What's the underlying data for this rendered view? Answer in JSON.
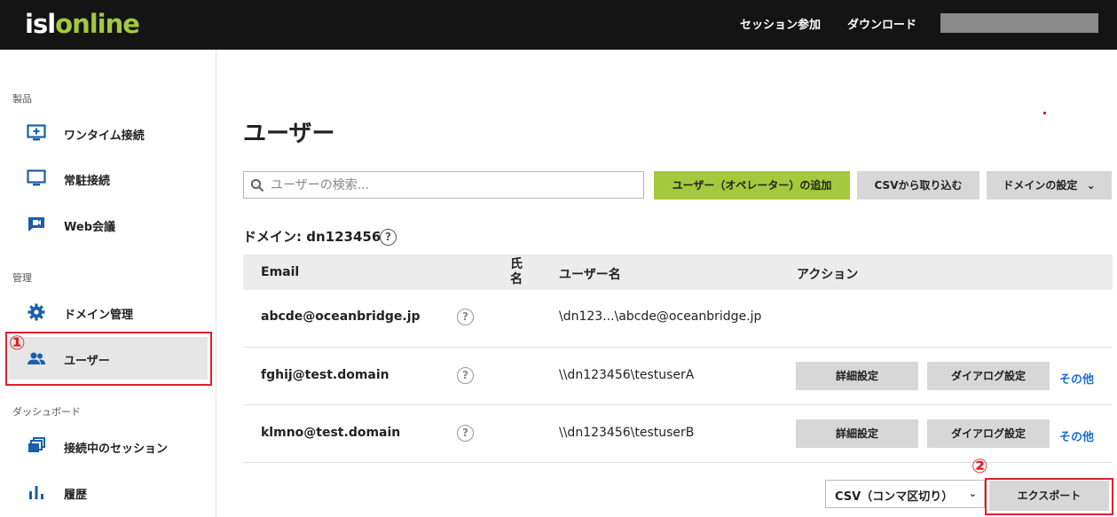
{
  "header": {
    "logo_part1": "isl",
    "logo_part2": "online",
    "nav": [
      "セッション参加",
      "ダウンロード"
    ]
  },
  "sidebar": {
    "sections": [
      {
        "label": "製品",
        "items": [
          {
            "label": "ワンタイム接続",
            "icon": "monitor-plus-icon"
          },
          {
            "label": "常駐接続",
            "icon": "monitor-icon"
          },
          {
            "label": "Web会議",
            "icon": "video-icon"
          }
        ]
      },
      {
        "label": "管理",
        "items": [
          {
            "label": "ドメイン管理",
            "icon": "gear-icon"
          },
          {
            "label": "ユーザー",
            "icon": "users-icon",
            "active": true
          }
        ]
      },
      {
        "label": "ダッシュボード",
        "items": [
          {
            "label": "接続中のセッション",
            "icon": "sessions-icon"
          },
          {
            "label": "履歴",
            "icon": "bar-chart-icon"
          }
        ]
      }
    ]
  },
  "main": {
    "title": "ユーザー",
    "search_placeholder": "ユーザーの検索...",
    "add_button": "ユーザー（オペレーター）の追加",
    "csv_import_button": "CSVから取り込む",
    "domain_settings_button": "ドメインの設定",
    "domain_label": "ドメイン: dn123456",
    "table": {
      "headers": [
        "Email",
        "氏名",
        "ユーザー名",
        "アクション"
      ],
      "rows": [
        {
          "email": "abcde@oceanbridge.jp",
          "username": "\\dn123...\\abcde@oceanbridge.jp",
          "actions": false
        },
        {
          "email": "fghij@test.domain",
          "username": "\\\\dn123456\\testuserA",
          "actions": true
        },
        {
          "email": "klmno@test.domain",
          "username": "\\\\dn123456\\testuserB",
          "actions": true
        }
      ],
      "action_detail": "詳細設定",
      "action_dialog": "ダイアログ設定",
      "action_other": "その他"
    },
    "export_format": "CSV（コンマ区切り）",
    "export_button": "エクスポート"
  },
  "annotations": [
    "①",
    "②"
  ],
  "colors": {
    "accent": "#a4c93c",
    "annotation": "#e0202a",
    "link": "#1c6fd1"
  }
}
